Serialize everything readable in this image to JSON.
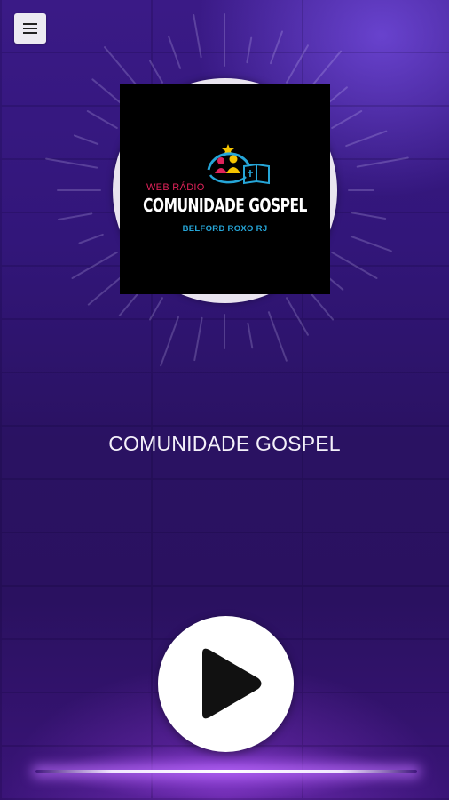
{
  "menu": {
    "icon": "hamburger-menu-icon"
  },
  "logo": {
    "web_label": "WEB RÁDIO",
    "main_label": "COMUNIDADE GOSPEL",
    "sub_label": "BELFORD ROXO RJ",
    "colors": {
      "web": "#e0235a",
      "main": "#ffffff",
      "sub": "#26a6d8",
      "star": "#f5c400",
      "person_pink": "#e0235a",
      "person_yellow": "#f5c400",
      "arc_blue": "#26a6d8"
    }
  },
  "station": {
    "name": "COMUNIDADE GOSPEL"
  },
  "player": {
    "icon": "play-icon"
  },
  "theme": {
    "background": "#2a1262",
    "accent": "#8a4dff"
  }
}
